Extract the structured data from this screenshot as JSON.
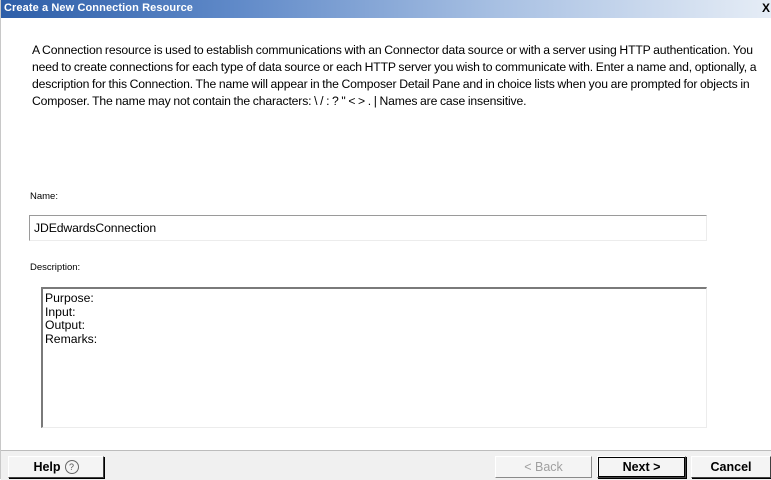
{
  "window": {
    "title": "Create a New Connection Resource",
    "close_glyph": "X"
  },
  "intro": {
    "text": "A Connection resource is used to establish communications with an Connector data source or with a server using HTTP authentication. You need to create connections for each type of data source or each HTTP server you wish to communicate with.  Enter a name and, optionally, a description for this Connection.  The name will appear in the Composer Detail Pane and in choice lists when you are prompted for objects in Composer.  The name may not contain the characters: \\ / : ? \" < > . |  Names are case insensitive."
  },
  "form": {
    "name_label": "Name:",
    "name_value": "JDEdwardsConnection",
    "description_label": "Description:",
    "description_value": "Purpose:\nInput:\nOutput:\nRemarks:"
  },
  "buttons": {
    "help_label": "Help",
    "help_icon": "?",
    "back_label": "< Back",
    "next_label": "Next >",
    "cancel_label": "Cancel"
  }
}
